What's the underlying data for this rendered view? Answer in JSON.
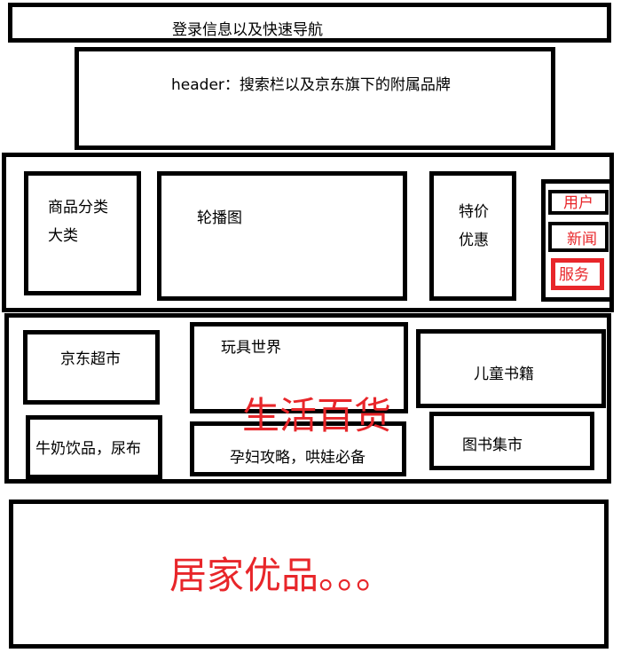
{
  "login_bar": {
    "label": "登录信息以及快速导航"
  },
  "header": {
    "label": "header：搜索栏以及京东旗下的附属品牌"
  },
  "main": {
    "category": {
      "line1": "商品分类",
      "line2": "大类"
    },
    "carousel": {
      "label": "轮播图"
    },
    "special": {
      "line1": "特价",
      "line2": "优惠"
    },
    "side": {
      "user": "用户",
      "news": "新闻",
      "service": "服务"
    }
  },
  "life": {
    "title": "生活百货",
    "jd_market": "京东超市",
    "toys": "玩具世界",
    "kids_books": "儿童书籍",
    "milk": "牛奶饮品，尿布",
    "pregnancy": "孕妇攻略，哄娃必备",
    "book_market": "图书集市"
  },
  "home": {
    "title": "居家优品。。。"
  },
  "colors": {
    "accent": "#e8262a",
    "border": "#000000"
  }
}
